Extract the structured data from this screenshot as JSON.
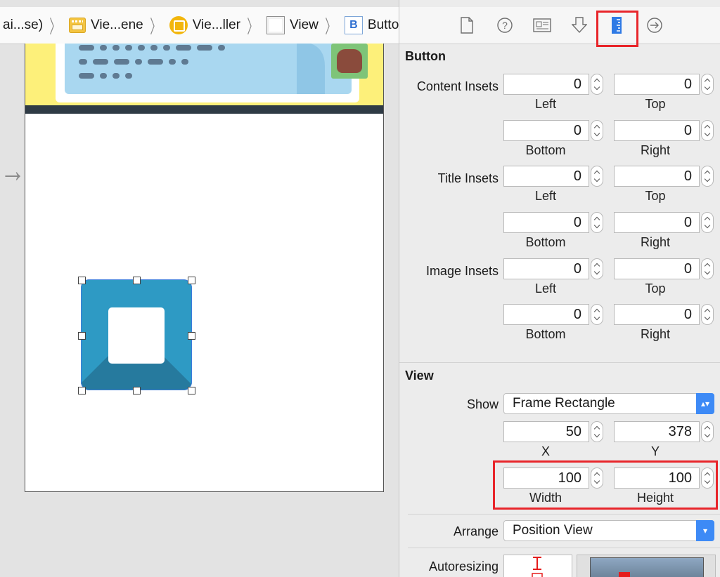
{
  "breadcrumb": {
    "items": [
      {
        "label": "ai...se)",
        "icon": "none"
      },
      {
        "label": "Vie...ene",
        "icon": "storyboard-scene-icon"
      },
      {
        "label": "Vie...ller",
        "icon": "view-controller-icon"
      },
      {
        "label": "View",
        "icon": "view-icon"
      },
      {
        "label": "Button",
        "icon": "button-icon",
        "icon_glyph": "B"
      }
    ]
  },
  "inspector": {
    "tabs": [
      "file-inspector-icon",
      "quick-help-icon",
      "identity-inspector-icon",
      "attributes-inspector-icon",
      "size-inspector-icon",
      "connections-inspector-icon"
    ],
    "active_tab": "size-inspector-icon",
    "button_section": {
      "title": "Button",
      "content_insets": {
        "label": "Content Insets",
        "left": "0",
        "top": "0",
        "bottom": "0",
        "right": "0"
      },
      "title_insets": {
        "label": "Title Insets",
        "left": "0",
        "top": "0",
        "bottom": "0",
        "right": "0"
      },
      "image_insets": {
        "label": "Image Insets",
        "left": "0",
        "top": "0",
        "bottom": "0",
        "right": "0"
      },
      "sublabels": {
        "left": "Left",
        "top": "Top",
        "bottom": "Bottom",
        "right": "Right"
      }
    },
    "view_section": {
      "title": "View",
      "show_label": "Show",
      "show_value": "Frame Rectangle",
      "x": "50",
      "y": "378",
      "x_label": "X",
      "y_label": "Y",
      "width": "100",
      "height": "100",
      "width_label": "Width",
      "height_label": "Height",
      "arrange_label": "Arrange",
      "arrange_value": "Position View",
      "autoresizing_label": "Autoresizing"
    }
  },
  "colors": {
    "highlight": "#e8252a",
    "button_fill": "#2e9ac4",
    "popup_accent": "#3d8af6"
  }
}
